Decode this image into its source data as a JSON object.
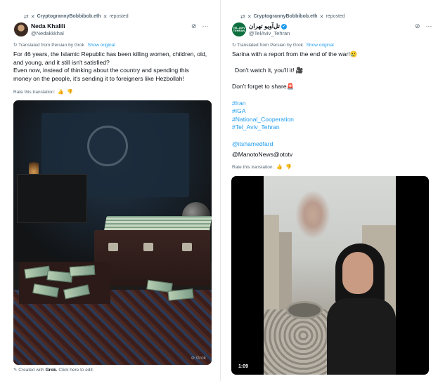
{
  "left_post": {
    "repost_user": "CryptogrannyBobbibob.eth",
    "repost_label": "reposted",
    "author_name": "Neda Khalili",
    "author_handle": "@Nedakkkhal",
    "translated_label": "Translated from Persian by Grok",
    "show_original": "Show original",
    "body_lines": [
      "For 46 years, the Islamic Republic has been killing women, children, old,",
      "and young, and it still isn't satisfied?",
      "Even now, instead of thinking about the country and spending this",
      "money on the people, it's sending it to foreigners like Hezbollah!"
    ],
    "rate_label": "Rate this translation:",
    "media_watermark": "Grok",
    "created_prefix": "Created with",
    "created_brand": "Grok.",
    "created_suffix": "Click here to edit."
  },
  "right_post": {
    "repost_user": "CryptogrannyBobbibob.eth",
    "repost_label": "reposted",
    "author_name": "تل‌آویو تهران",
    "author_handle": "@TelAviv_Tehran",
    "avatar_text": "TEL-AVIV TEHRAN",
    "translated_label": "Translated from Persian by Grok",
    "show_original": "Show original",
    "line1": "Sarina with a report from the end of the war!😢",
    "line2": "Don't watch it, you'll it! 🎥",
    "line3": "Don't forget to share🚨",
    "hashtags": [
      "#Iran",
      "#IGA",
      "#National_Cooperation",
      "#Tel_Aviv_Tehran"
    ],
    "mention1": "@itshamedfard",
    "mention2": "@ManotoNews@ototv",
    "rate_label": "Rate this translation:",
    "video_time": "1:09"
  },
  "icons": {
    "repost": "repost-icon",
    "grok": "grok-icon",
    "more": "more-icon",
    "translate": "translate-icon",
    "thumbs_up": "thumbs-up-icon",
    "thumbs_down": "thumbs-down-icon",
    "verified": "verified-badge-icon",
    "edit": "edit-icon"
  },
  "colors": {
    "link": "#1d9bf0",
    "secondary_text": "#536471",
    "primary_text": "#0f1419"
  }
}
